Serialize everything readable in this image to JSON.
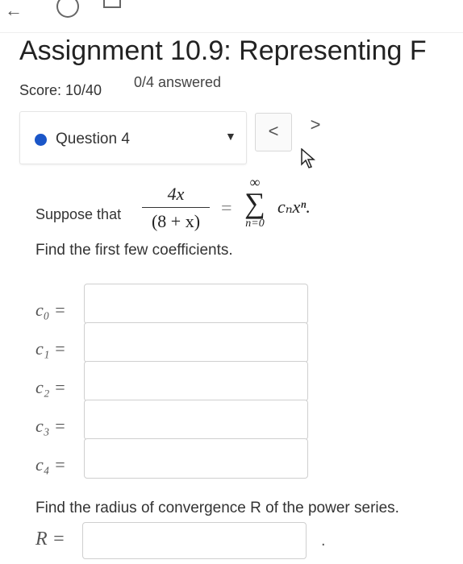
{
  "header": {
    "title": "Assignment 10.9: Representing F",
    "score": "Score: 10/40",
    "answered": "0/4 answered"
  },
  "question_nav": {
    "label": "Question 4",
    "prev_label": "<",
    "next_label": ">"
  },
  "problem": {
    "prompt": "Suppose that",
    "numerator": "4x",
    "denominator": "(8 + x)",
    "equals": "=",
    "sum_upper": "∞",
    "sum_lower": "n=0",
    "sum_term": "cₙxⁿ.",
    "instruction": "Find the first few coefficients."
  },
  "coefficients": [
    {
      "label": "c₀ =",
      "value": ""
    },
    {
      "label": "c₁ =",
      "value": ""
    },
    {
      "label": "c₂ =",
      "value": ""
    },
    {
      "label": "c₃ =",
      "value": ""
    },
    {
      "label": "c₄ =",
      "value": ""
    }
  ],
  "radius": {
    "text": "Find the radius of convergence R of the power series.",
    "label": "R =",
    "value": "",
    "trailing": "."
  },
  "colors": {
    "accent": "#1b56c8"
  }
}
